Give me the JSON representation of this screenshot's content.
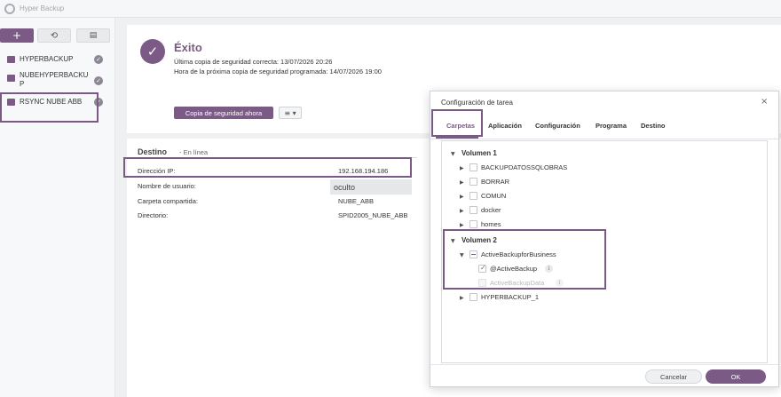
{
  "app": {
    "title": "Hyper Backup"
  },
  "toolbar": {
    "add_label": "+",
    "restore_icon": "restore-history-icon",
    "log_icon": "log-document-icon"
  },
  "tasks": [
    {
      "label": "HYPERBACKUP"
    },
    {
      "label_line1": "NUBEHYPERBACKU",
      "label_line2": "P"
    },
    {
      "label": "RSYNC NUBE ABB"
    }
  ],
  "status": {
    "title": "Éxito",
    "last_backup": "Última copia de seguridad correcta: 13/07/2026 20:26",
    "next_backup": "Hora de la próxima copia de seguridad programada: 14/07/2026 19:00",
    "backup_now_label": "Copia de seguridad ahora"
  },
  "destination": {
    "title": "Destino",
    "state": "- En línea",
    "rows": [
      {
        "label": "Dirección IP:",
        "value": "192.168.194.186"
      },
      {
        "label": "Nombre de usuario:",
        "value": "oculto"
      },
      {
        "label": "Carpeta compartida:",
        "value": "NUBE_ABB"
      },
      {
        "label": "Directorio:",
        "value": "SPID2005_NUBE_ABB"
      }
    ]
  },
  "dialog": {
    "title": "Configuración de tarea",
    "close": "×",
    "tabs": [
      "Carpetas",
      "Aplicación",
      "Configuración",
      "Programa",
      "Destino"
    ],
    "volume1": {
      "label": "Volumen 1",
      "folders": [
        "BACKUPDATOSSQLOBRAS",
        "BORRAR",
        "COMUN",
        "docker",
        "homes"
      ]
    },
    "volume2": {
      "label": "Volumen 2",
      "parent": "ActiveBackupforBusiness",
      "children": [
        "@ActiveBackup",
        "ActiveBackupData"
      ],
      "extra": "HYPERBACKUP_1"
    },
    "cancel_label": "Cancelar",
    "ok_label": "OK"
  }
}
